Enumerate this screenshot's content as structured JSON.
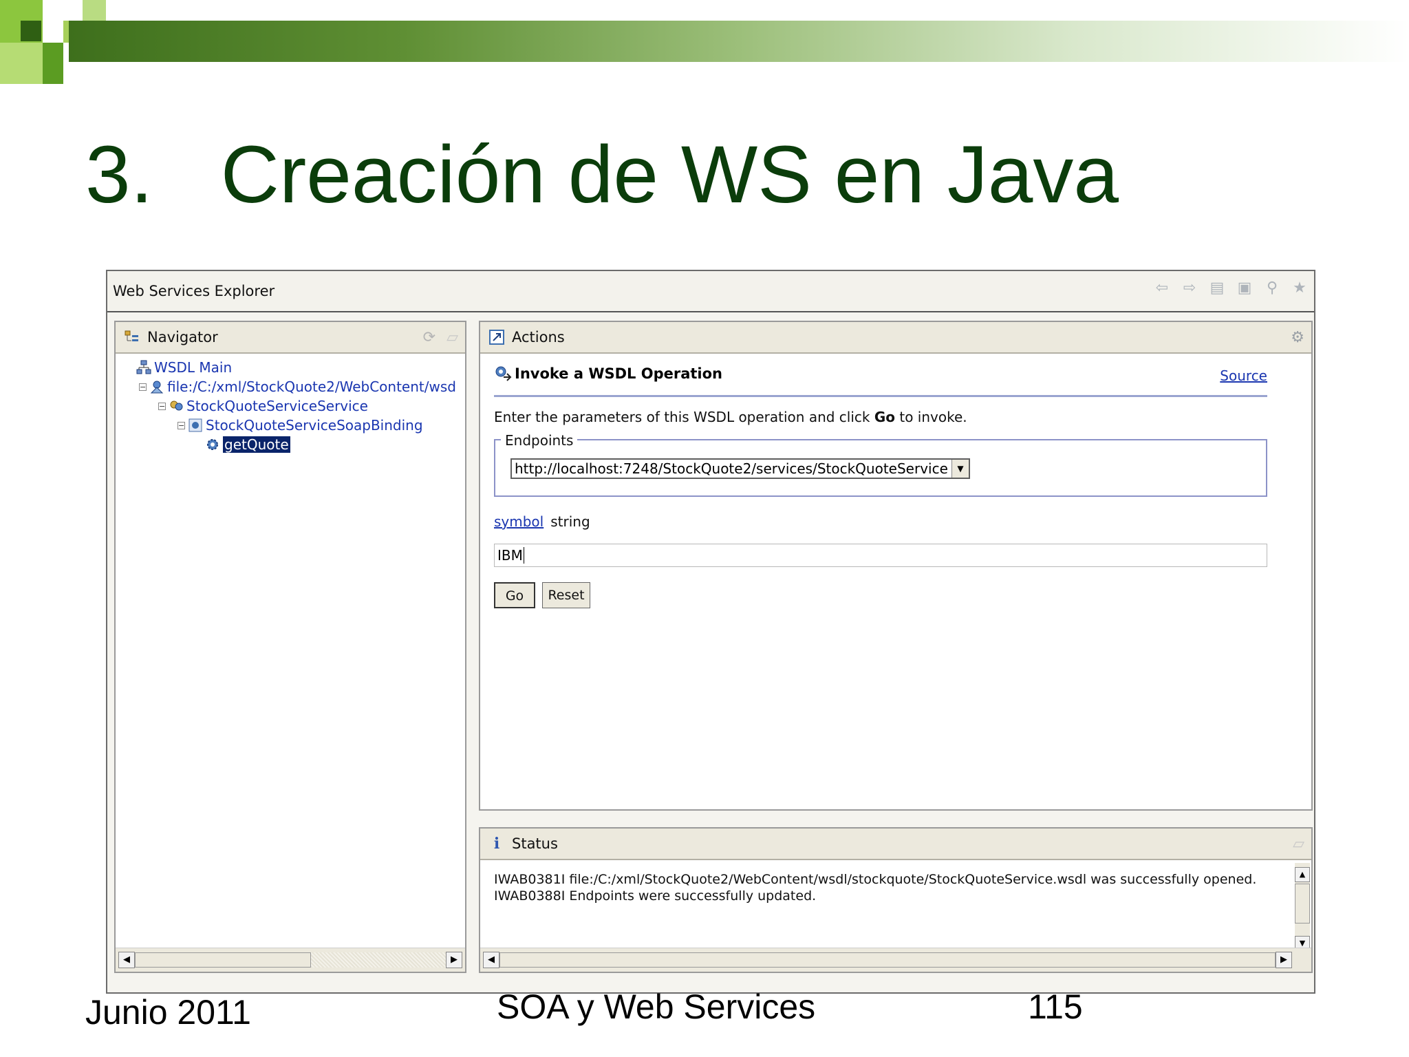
{
  "slide": {
    "title_number": "3.",
    "title_text": "Creación de WS en Java",
    "footer_left": "Junio 2011",
    "footer_center": "SOA y Web Services",
    "footer_right": "115"
  },
  "window": {
    "title": "Web Services Explorer",
    "toolbar_icons": [
      "back-icon",
      "forward-icon",
      "uddi-page-icon",
      "wsil-page-icon",
      "wsdl-page-icon",
      "favorites-icon"
    ]
  },
  "navigator": {
    "title": "Navigator",
    "tree": [
      {
        "label": "WSDL Main",
        "icon": "wsdl-main-icon"
      },
      {
        "label": "file:/C:/xml/StockQuote2/WebContent/wsd",
        "icon": "wsdl-file-icon"
      },
      {
        "label": "StockQuoteServiceService",
        "icon": "service-icon"
      },
      {
        "label": "StockQuoteServiceSoapBinding",
        "icon": "binding-icon"
      },
      {
        "label": "getQuote",
        "icon": "operation-icon"
      }
    ]
  },
  "actions": {
    "title": "Actions",
    "heading": "Invoke a WSDL Operation",
    "source_link": "Source",
    "hint_prefix": "Enter the parameters of this WSDL operation and click ",
    "hint_bold": "Go",
    "hint_suffix": " to invoke.",
    "endpoints_label": "Endpoints",
    "endpoint_value": "http://localhost:7248/StockQuote2/services/StockQuoteService",
    "param_name": "symbol",
    "param_type": "string",
    "param_value": "IBM",
    "go_label": "Go",
    "reset_label": "Reset"
  },
  "status": {
    "title": "Status",
    "line1": "IWAB0381I file:/C:/xml/StockQuote2/WebContent/wsdl/stockquote/StockQuoteService.wsdl was successfully opened.",
    "line2": "IWAB0388I Endpoints were successfully updated."
  }
}
